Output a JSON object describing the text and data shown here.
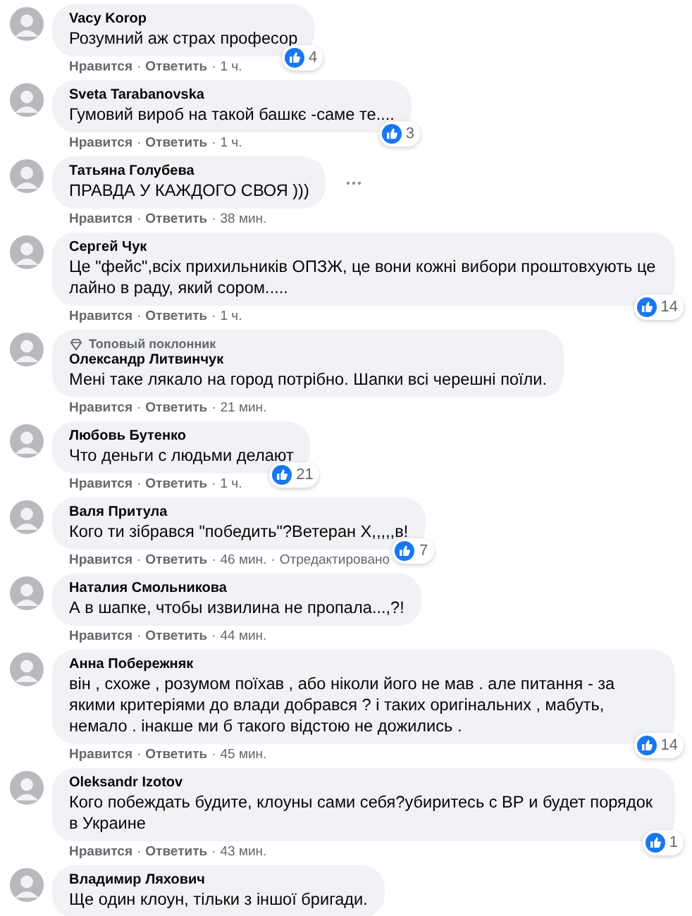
{
  "separator": "·",
  "comments": [
    {
      "author": "Vacy Korop",
      "text": "Розумний аж страх професор",
      "actions": [
        "Нравится",
        "Ответить",
        "1 ч."
      ],
      "reactions": "4"
    },
    {
      "author": "Sveta Tarabanovska",
      "text": "Гумовий вироб на такой башкє -саме те....",
      "actions": [
        "Нравится",
        "Ответить",
        "1 ч."
      ],
      "reactions": "3"
    },
    {
      "author": "Татьяна Голубева",
      "text": "ПРАВДА У КАЖДОГО СВОЯ )))",
      "actions": [
        "Нравится",
        "Ответить",
        "38 мин."
      ],
      "more_menu": true
    },
    {
      "author": "Сергей Чук",
      "text": "Це \"фейс\",всіх прихильників ОПЗЖ, це вони кожні вибори проштовхують це лайно в раду, який сором.....",
      "actions": [
        "Нравится",
        "Ответить",
        "1 ч."
      ],
      "reactions": "14"
    },
    {
      "badge": "Топовый поклонник",
      "author": "Олександр Литвинчук",
      "text": "Мені таке лякало на город потрібно. Шапки всі черешні поїли.",
      "actions": [
        "Нравится",
        "Ответить",
        "21 мин."
      ]
    },
    {
      "author": "Любовь Бутенко",
      "text": "Что деньги с людьми делают",
      "actions": [
        "Нравится",
        "Ответить",
        "1 ч."
      ],
      "reactions": "21"
    },
    {
      "author": "Валя Притула",
      "text": "Кого ти зібрався \"победить\"?Ветеран Х,,,,,в!",
      "actions": [
        "Нравится",
        "Ответить",
        "46 мин.",
        "Отредактировано"
      ],
      "reactions": "7"
    },
    {
      "author": "Наталия Смольникова",
      "text": "А в шапке, чтобы извилина не пропала...,?!",
      "actions": [
        "Нравится",
        "Ответить",
        "44 мин."
      ]
    },
    {
      "author": "Анна Побережняк",
      "text": "він , схоже , розумом поїхав , або ніколи його не мав . але питання - за якими критеріями до влади добрався ?   і таких оригінальних , мабуть, немало . інакше ми б такого відстою не дожились .",
      "actions": [
        "Нравится",
        "Ответить",
        "45 мин."
      ],
      "reactions": "14"
    },
    {
      "author": "Oleksandr Izotov",
      "text": "Кого побеждать будите, клоуны сами себя?убиритесь с ВР и будет порядок в Украине",
      "actions": [
        "Нравится",
        "Ответить",
        "43 мин."
      ],
      "reactions": "1"
    },
    {
      "author": "Владимир Ляхович",
      "text": "Ще один клоун, тільки з іншої бригади."
    }
  ]
}
